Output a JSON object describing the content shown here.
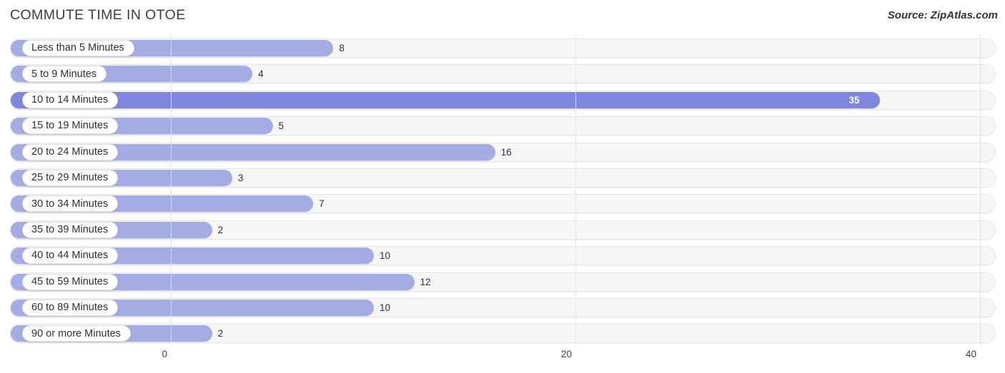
{
  "header": {
    "title": "COMMUTE TIME IN OTOE",
    "source": "Source: ZipAtlas.com"
  },
  "colors": {
    "bar": "#a3ade4",
    "bar_highlight": "#7c87dd",
    "track": "#f6f6f7",
    "gridline": "#e2e2e6",
    "text": "#2f2f3b"
  },
  "axis": {
    "ticks": [
      {
        "label": "0",
        "value": 0
      },
      {
        "label": "20",
        "value": 20
      },
      {
        "label": "40",
        "value": 40
      }
    ]
  },
  "chart_data": {
    "type": "bar",
    "orientation": "horizontal",
    "title": "COMMUTE TIME IN OTOE",
    "subtitle": "Source: ZipAtlas.com",
    "xlabel": "",
    "ylabel": "",
    "xlim": [
      0,
      40
    ],
    "grid": true,
    "legend": false,
    "highlight_category": "10 to 14 Minutes",
    "categories": [
      "Less than 5 Minutes",
      "5 to 9 Minutes",
      "10 to 14 Minutes",
      "15 to 19 Minutes",
      "20 to 24 Minutes",
      "25 to 29 Minutes",
      "30 to 34 Minutes",
      "35 to 39 Minutes",
      "40 to 44 Minutes",
      "45 to 59 Minutes",
      "60 to 89 Minutes",
      "90 or more Minutes"
    ],
    "values": [
      8,
      4,
      35,
      5,
      16,
      3,
      7,
      2,
      10,
      12,
      10,
      2
    ],
    "value_labels": [
      "8",
      "4",
      "35",
      "5",
      "16",
      "3",
      "7",
      "2",
      "10",
      "12",
      "10",
      "2"
    ]
  }
}
